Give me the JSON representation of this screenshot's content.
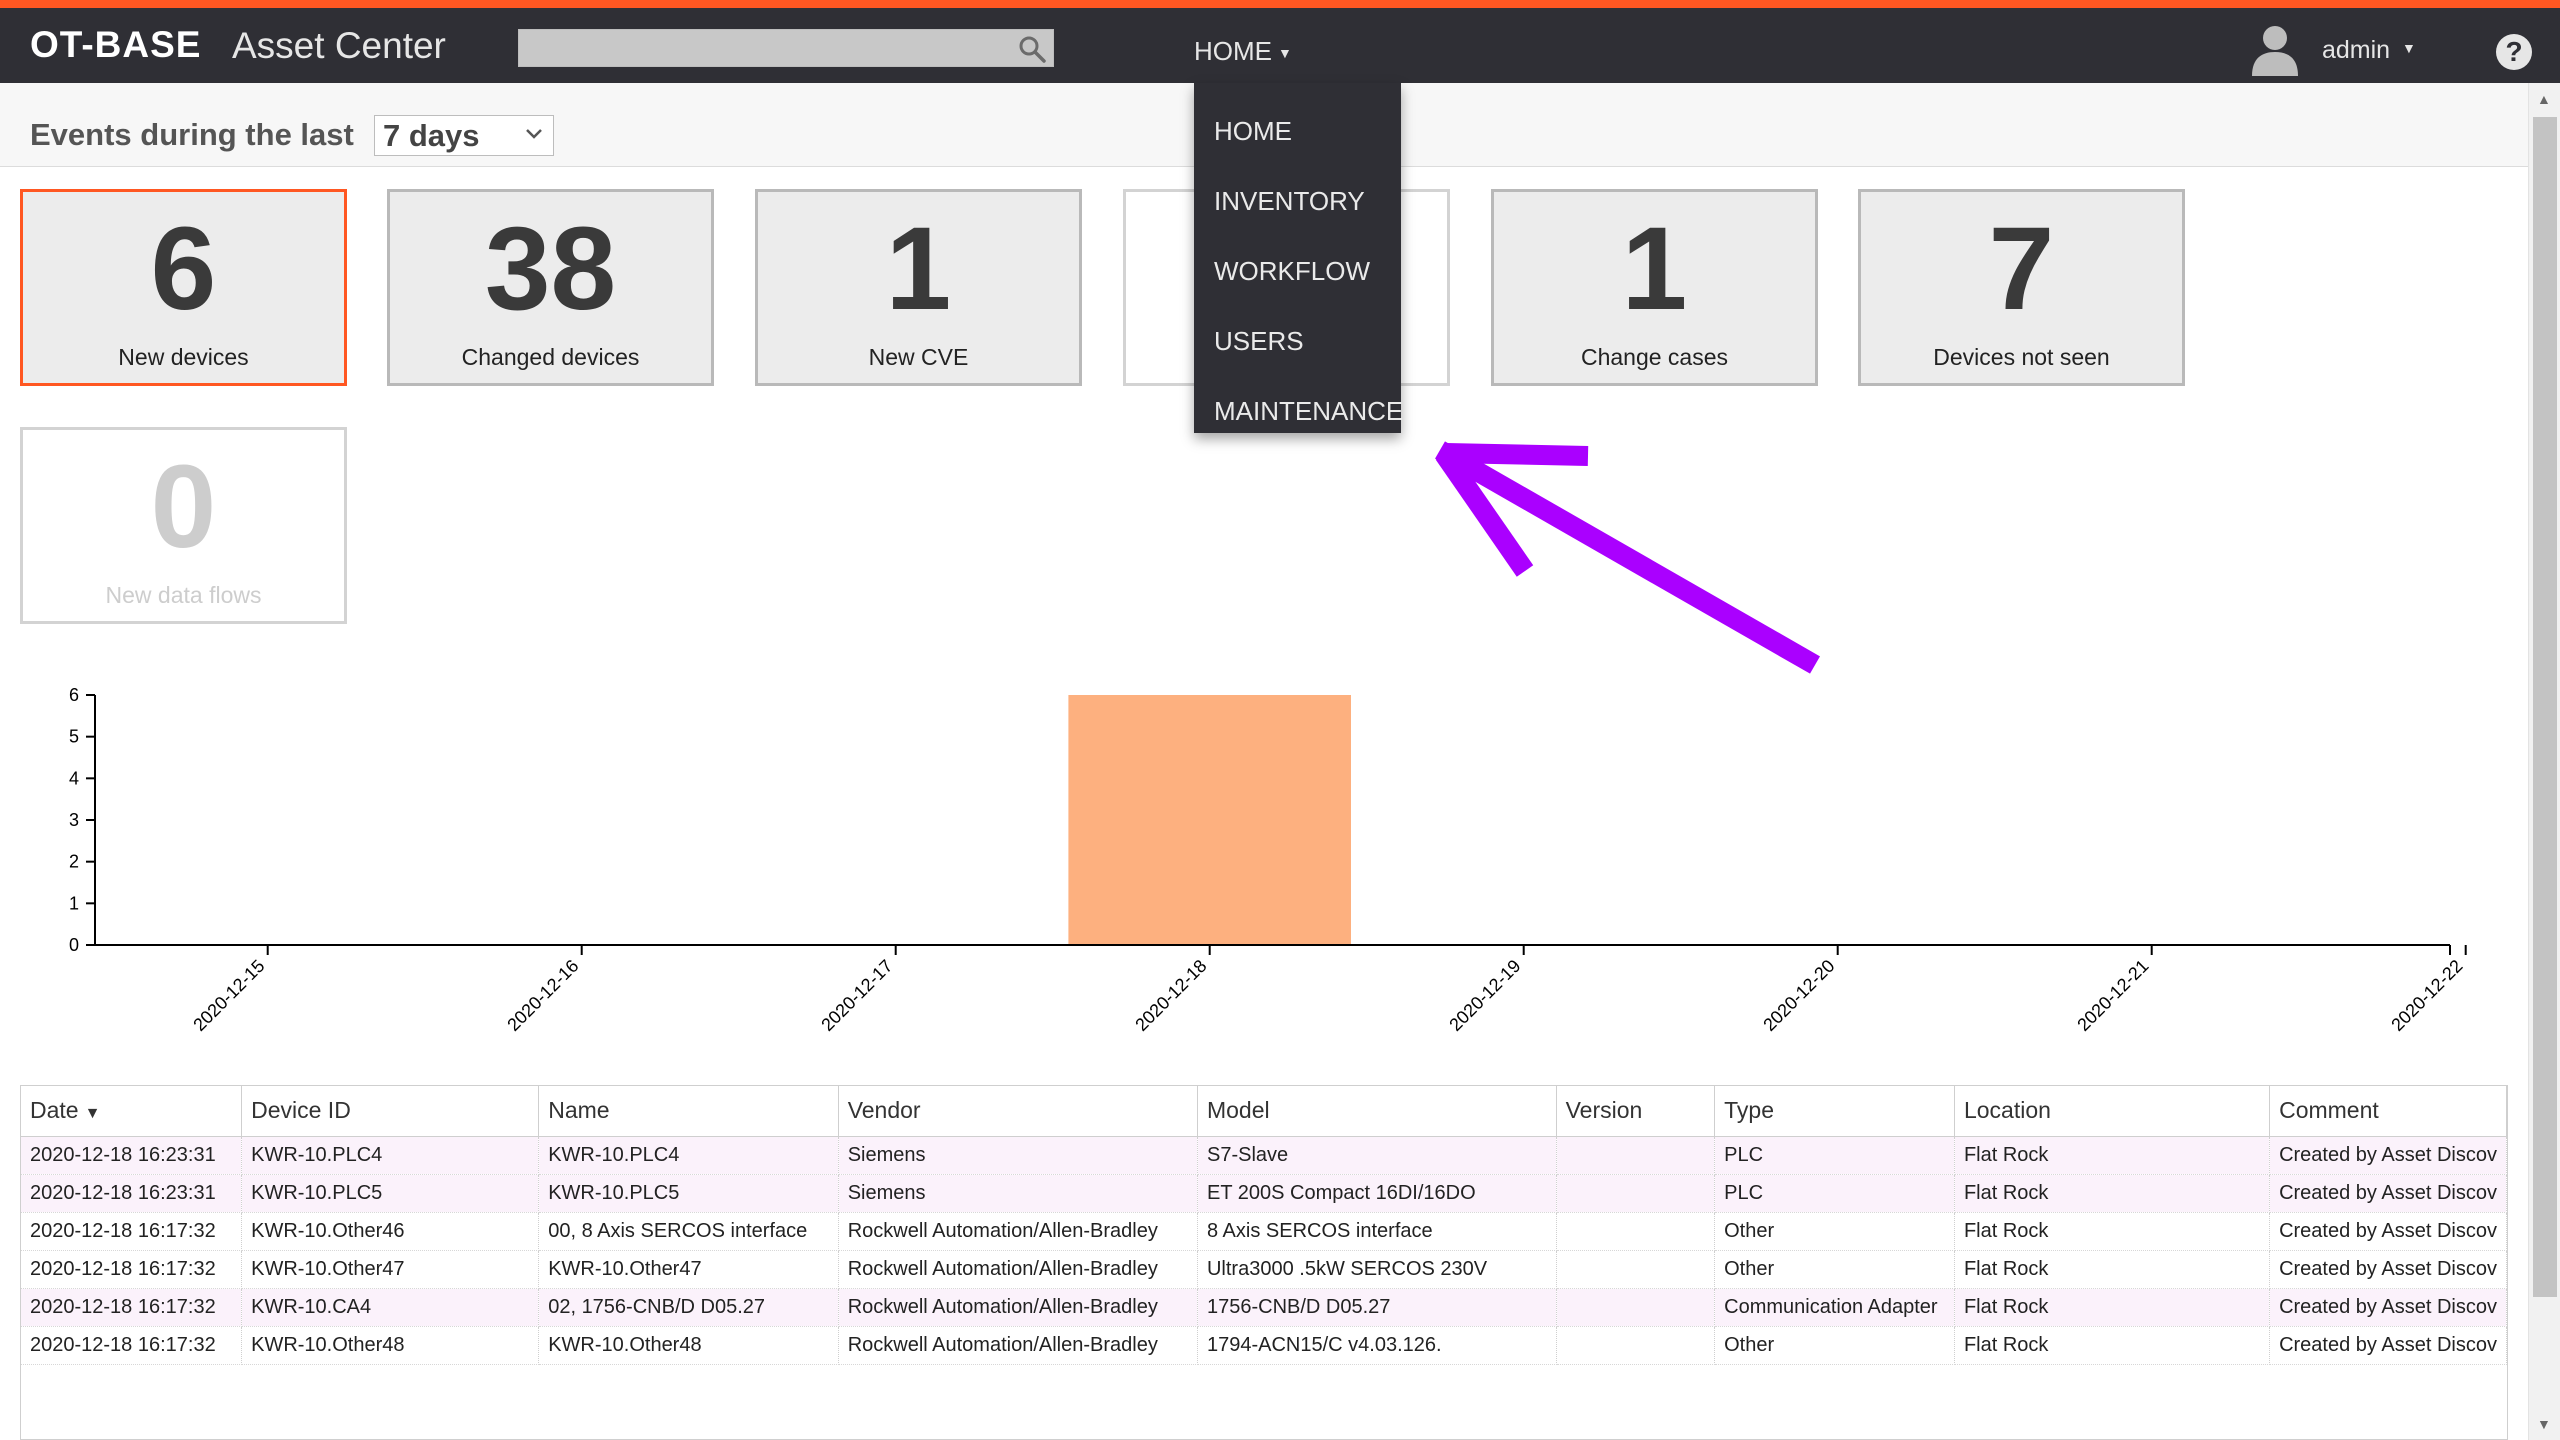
{
  "app": {
    "brand": "OT-BASE",
    "subtitle": "Asset Center"
  },
  "search": {
    "placeholder": ""
  },
  "nav": {
    "home_label": "HOME"
  },
  "user": {
    "name": "admin"
  },
  "help": {
    "label": "?"
  },
  "filter": {
    "label": "Events during the last",
    "selected": "7 days"
  },
  "tiles": [
    {
      "value": "6",
      "label": "New devices"
    },
    {
      "value": "38",
      "label": "Changed devices"
    },
    {
      "value": "1",
      "label": "New CVE"
    },
    {
      "value": "",
      "label": ""
    },
    {
      "value": "1",
      "label": "Change cases"
    },
    {
      "value": "7",
      "label": "Devices not seen"
    },
    {
      "value": "0",
      "label": "New data flows"
    }
  ],
  "dropdown": {
    "items": [
      "HOME",
      "INVENTORY",
      "WORKFLOW",
      "USERS",
      "MAINTENANCE"
    ]
  },
  "chart_data": {
    "type": "bar",
    "categories": [
      "2020-12-15",
      "2020-12-16",
      "2020-12-17",
      "2020-12-18",
      "2020-12-19",
      "2020-12-20",
      "2020-12-21",
      "2020-12-22"
    ],
    "values": [
      0,
      0,
      0,
      6,
      0,
      0,
      0,
      0
    ],
    "ylim": [
      0,
      6
    ],
    "yticks": [
      0,
      1,
      2,
      3,
      4,
      5,
      6
    ],
    "bar_color": "#fdb07f",
    "grid": false
  },
  "table": {
    "columns": [
      "Date",
      "Device ID",
      "Name",
      "Vendor",
      "Model",
      "Version",
      "Type",
      "Location",
      "Comment"
    ],
    "rows": [
      [
        "2020-12-18 16:23:31",
        "KWR-10.PLC4",
        "KWR-10.PLC4",
        "Siemens",
        "S7-Slave",
        "",
        "PLC",
        "Flat Rock",
        "Created by Asset Discov"
      ],
      [
        "2020-12-18 16:23:31",
        "KWR-10.PLC5",
        "KWR-10.PLC5",
        "Siemens",
        "ET 200S Compact 16DI/16DO",
        "",
        "PLC",
        "Flat Rock",
        "Created by Asset Discov"
      ],
      [
        "2020-12-18 16:17:32",
        "KWR-10.Other46",
        "00, 8 Axis SERCOS interface",
        "Rockwell Automation/Allen-Bradley",
        "8 Axis SERCOS interface",
        "",
        "Other",
        "Flat Rock",
        "Created by Asset Discov"
      ],
      [
        "2020-12-18 16:17:32",
        "KWR-10.Other47",
        "KWR-10.Other47",
        "Rockwell Automation/Allen-Bradley",
        "Ultra3000 .5kW SERCOS 230V",
        "",
        "Other",
        "Flat Rock",
        "Created by Asset Discov"
      ],
      [
        "2020-12-18 16:17:32",
        "KWR-10.CA4",
        "02, 1756-CNB/D D05.27",
        "Rockwell Automation/Allen-Bradley",
        "1756-CNB/D D05.27",
        "",
        "Communication Adapter",
        "Flat Rock",
        "Created by Asset Discov"
      ],
      [
        "2020-12-18 16:17:32",
        "KWR-10.Other48",
        "KWR-10.Other48",
        "Rockwell Automation/Allen-Bradley",
        "1794-ACN15/C v4.03.126.",
        "",
        "Other",
        "Flat Rock",
        "Created by Asset Discov"
      ]
    ]
  },
  "colors": {
    "accent": "#ff5722",
    "navbar": "#2f2f35",
    "annotation_arrow": "#aa00ff"
  }
}
